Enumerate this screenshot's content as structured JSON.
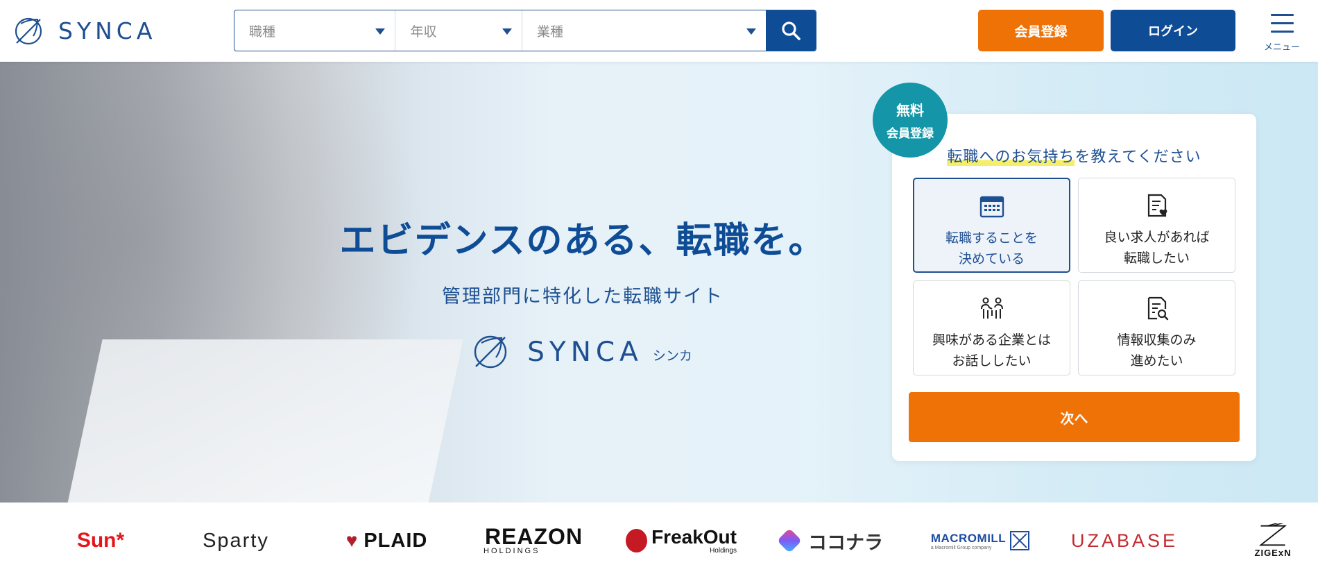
{
  "header": {
    "logo_text": "SYNCA",
    "search": {
      "job_type_placeholder": "職種",
      "income_placeholder": "年収",
      "industry_placeholder": "業種"
    },
    "register_label": "会員登録",
    "login_label": "ログイン",
    "menu_label": "メニュー"
  },
  "hero": {
    "headline": "エビデンスのある、転職を。",
    "subheadline": "管理部門に特化した転職サイト",
    "logo_text": "SYNCA",
    "logo_kana": "シンカ"
  },
  "signup_card": {
    "badge_line1": "無料",
    "badge_line2": "会員登録",
    "title_highlight": "転職へのお気持ち",
    "title_rest": "を教えてください",
    "options": [
      {
        "label": "転職することを\n決めている",
        "icon": "calendar-icon",
        "selected": true
      },
      {
        "label": "良い求人があれば\n転職したい",
        "icon": "document-heart-icon",
        "selected": false
      },
      {
        "label": "興味がある企業とは\nお話ししたい",
        "icon": "people-talk-icon",
        "selected": false
      },
      {
        "label": "情報収集のみ\n進めたい",
        "icon": "document-search-icon",
        "selected": false
      }
    ],
    "next_label": "次へ"
  },
  "partner_logos": {
    "sun": "Sun*",
    "sparty": "Sparty",
    "plaid": "PLAID",
    "reazon": "REAZON",
    "reazon_sub": "HOLDINGS",
    "freakout": "FreakOut",
    "freakout_sub": "Holdings",
    "kokonara": "ココナラ",
    "macromill": "MACROMILL",
    "macromill_sub": "a Macromill Group company",
    "uzabase": "UZABASE",
    "zigexn": "ZIGExN"
  },
  "colors": {
    "brand_blue": "#0f4c96",
    "accent_orange": "#ef7206",
    "badge_teal": "#1496a8"
  }
}
